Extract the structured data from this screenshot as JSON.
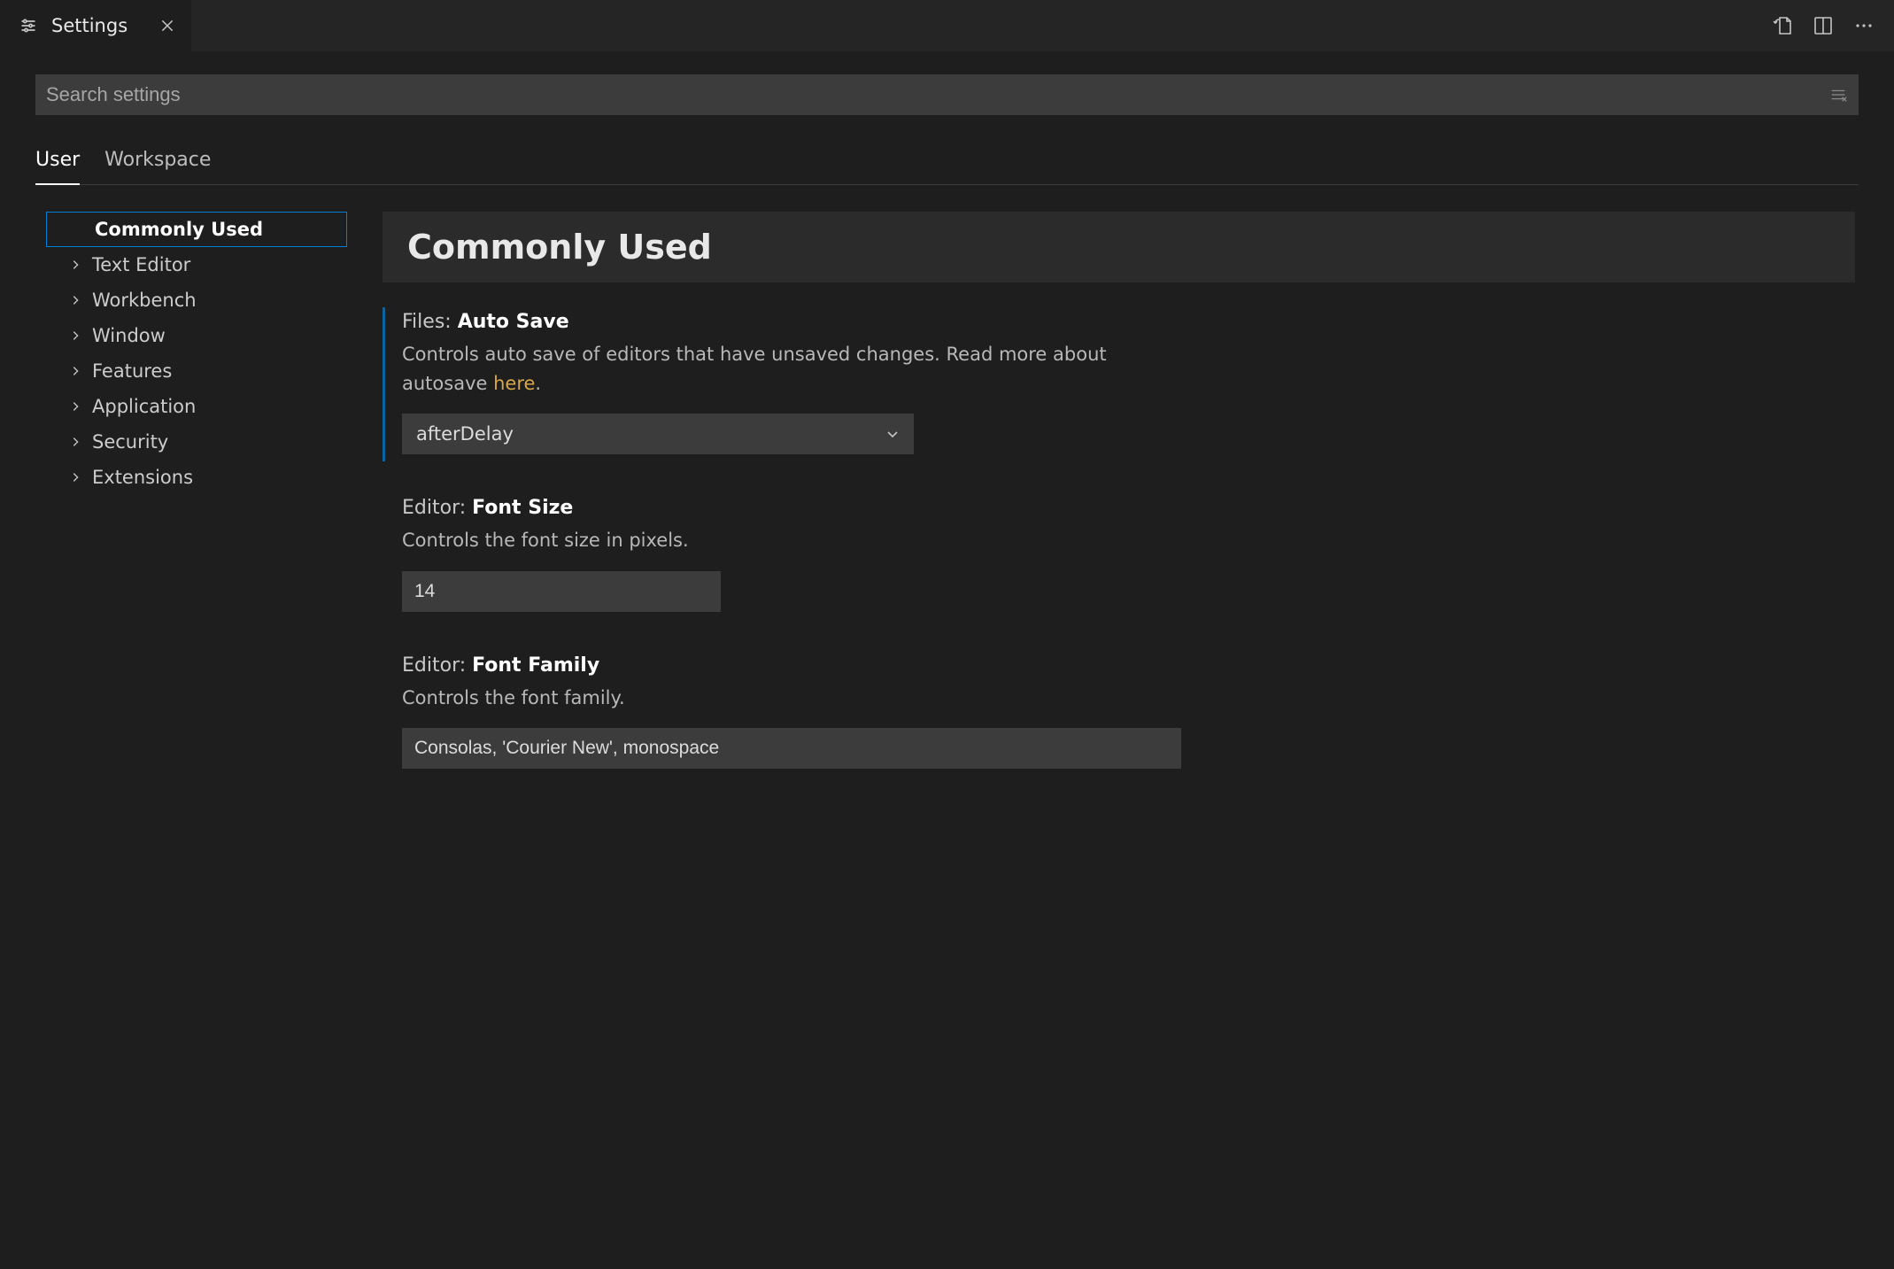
{
  "tab": {
    "title": "Settings"
  },
  "search": {
    "placeholder": "Search settings"
  },
  "scope": {
    "tabs": [
      "User",
      "Workspace"
    ],
    "activeIndex": 0
  },
  "tree": {
    "items": [
      {
        "label": "Commonly Used",
        "selected": true,
        "expandable": false
      },
      {
        "label": "Text Editor",
        "selected": false,
        "expandable": true
      },
      {
        "label": "Workbench",
        "selected": false,
        "expandable": true
      },
      {
        "label": "Window",
        "selected": false,
        "expandable": true
      },
      {
        "label": "Features",
        "selected": false,
        "expandable": true
      },
      {
        "label": "Application",
        "selected": false,
        "expandable": true
      },
      {
        "label": "Security",
        "selected": false,
        "expandable": true
      },
      {
        "label": "Extensions",
        "selected": false,
        "expandable": true
      }
    ]
  },
  "section": {
    "title": "Commonly Used"
  },
  "settings": {
    "autoSave": {
      "prefix": "Files:",
      "name": "Auto Save",
      "descriptionPre": "Controls auto save of editors that have unsaved changes. Read more about autosave ",
      "linkText": "here",
      "descriptionPost": ".",
      "value": "afterDelay",
      "modified": true
    },
    "fontSize": {
      "prefix": "Editor:",
      "name": "Font Size",
      "description": "Controls the font size in pixels.",
      "value": "14",
      "modified": false
    },
    "fontFamily": {
      "prefix": "Editor:",
      "name": "Font Family",
      "description": "Controls the font family.",
      "value": "Consolas, 'Courier New', monospace",
      "modified": false
    }
  }
}
